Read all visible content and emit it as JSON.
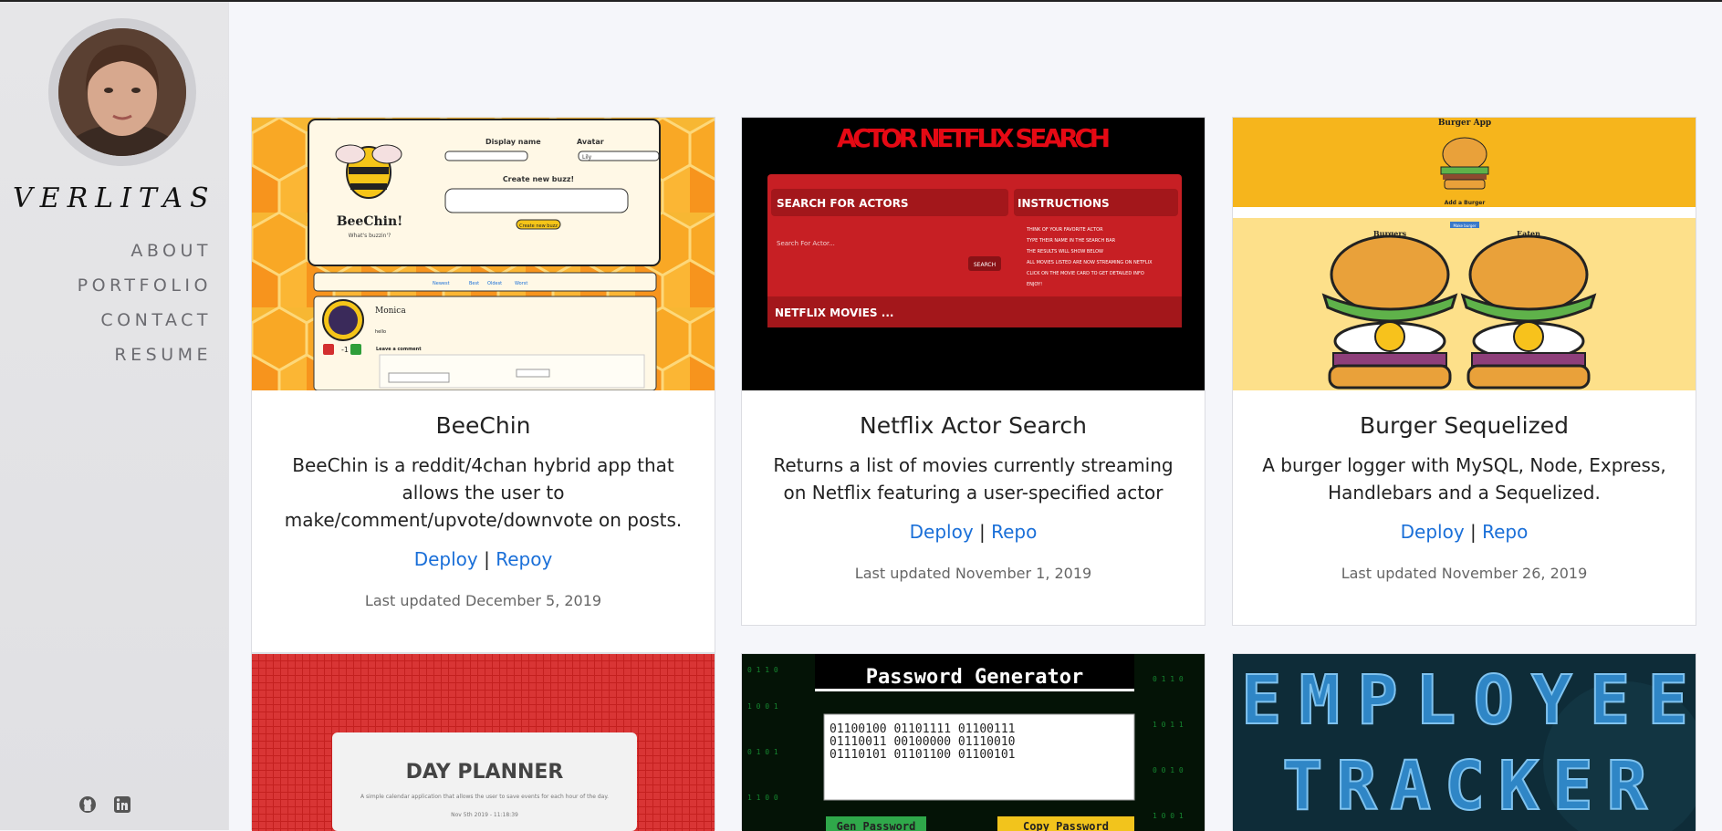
{
  "sidebar": {
    "brand": "VERLITAS",
    "nav": [
      "ABOUT",
      "PORTFOLIO",
      "CONTACT",
      "RESUME"
    ],
    "social": [
      "github-icon",
      "linkedin-icon"
    ]
  },
  "projects": [
    {
      "title": "BeeChin",
      "desc": "BeeChin is a reddit/4chan hybrid app that allows the user to make/comment/upvote/downvote on posts.",
      "link1": "Deploy",
      "sep": "|",
      "link2": "Repoy",
      "updated": "Last updated December 5, 2019",
      "thumb": {
        "app_title": "BeeChin!",
        "tagline": "What's buzzin'?",
        "display_name": "Display name",
        "avatar_label": "Avatar",
        "avatar_value": "Lily",
        "create": "Create new buzz!",
        "button": "Create new buzz",
        "tabs": [
          "Newest",
          "Best",
          "Oldest",
          "Worst"
        ],
        "post_user": "Monica",
        "post_text": "hello",
        "score": "-1",
        "comment_header": "Leave a comment"
      }
    },
    {
      "title": "Netflix Actor Search",
      "desc": "Returns a list of movies currently streaming on Netflix featuring a user-specified actor",
      "link1": "Deploy",
      "sep": "|",
      "link2": "Repo",
      "updated": "Last updated November 1, 2019",
      "thumb": {
        "header": "ACTOR NETFLIX SEARCH",
        "search_panel": "SEARCH FOR ACTORS",
        "instructions_panel": "INSTRUCTIONS",
        "placeholder": "Search For Actor...",
        "search_btn": "SEARCH",
        "instructions": [
          "THINK OF YOUR FAVORITE ACTOR",
          "TYPE THEIR NAME IN THE SEARCH BAR",
          "THE RESULTS WILL SHOW BELOW",
          "ALL MOVIES LISTED ARE NOW STREAMING ON NETFLIX",
          "CLICK ON THE MOVIE CARD TO GET DETAILED INFO",
          "ENJOY!"
        ],
        "movies_label": "NETFLIX MOVIES ..."
      }
    },
    {
      "title": "Burger Sequelized",
      "desc": "A burger logger with MySQL, Node, Express, Handlebars and a Sequelized.",
      "link1": "Deploy",
      "sep": "|",
      "link2": "Repo",
      "updated": "Last updated November 26, 2019",
      "thumb": {
        "app_title": "Burger App",
        "add": "Add a Burger",
        "button": "Make burger",
        "col1": "Burgers",
        "col2": "Eaten"
      }
    },
    {
      "thumb": {
        "header": "DAY PLANNER",
        "sub": "A simple calendar application that allows the user to save events for each hour of the day.",
        "date": "Nov 5th 2019 - 11:18:39"
      }
    },
    {
      "thumb": {
        "header": "Password Generator",
        "binary": [
          "01100100 01101111 01100111",
          "01110011 00100000 01110010",
          "01110101 01101100 01100101"
        ],
        "btn1": "Gen Password",
        "btn2": "Copy Password"
      }
    },
    {
      "thumb": {
        "line1": "EMPLOYEE",
        "line2": "TRACKER"
      }
    }
  ]
}
